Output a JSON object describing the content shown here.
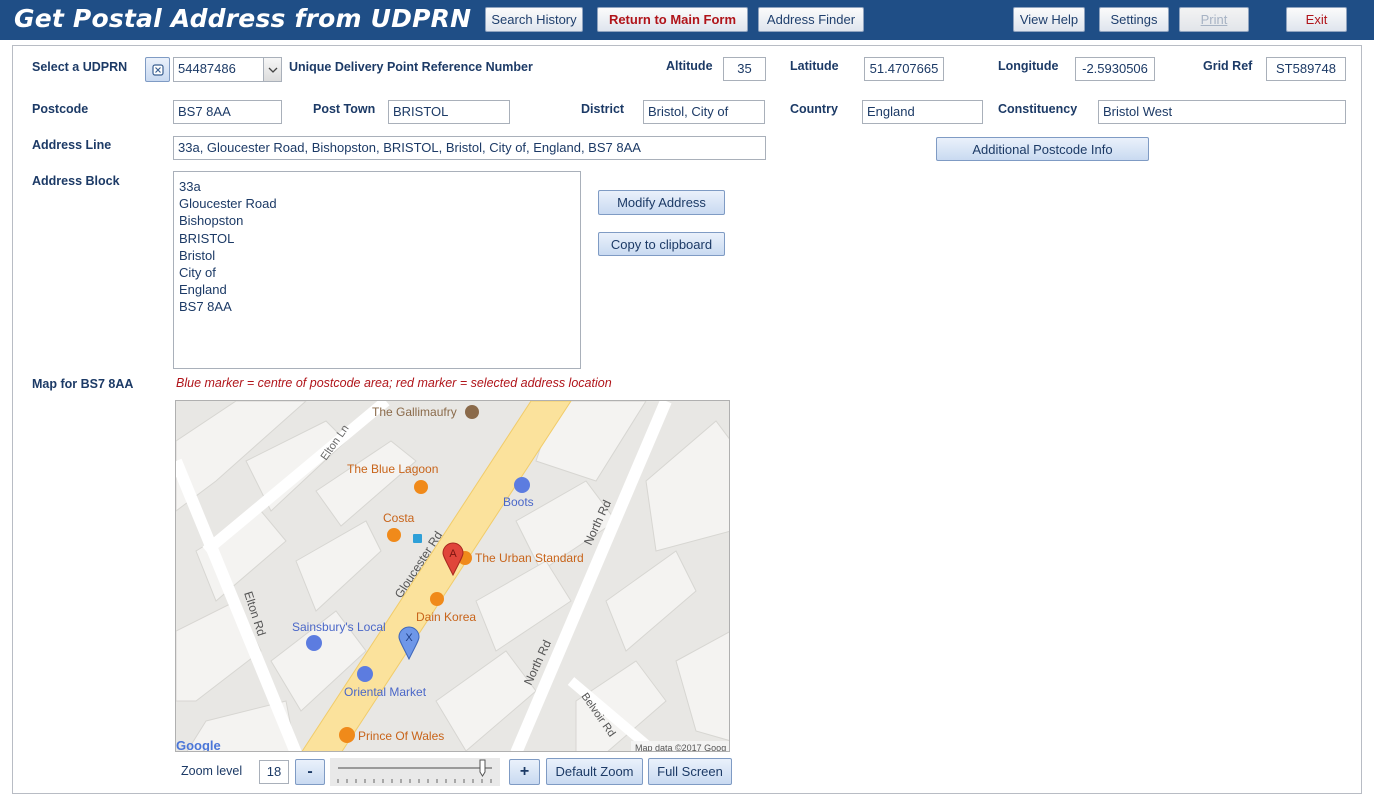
{
  "window": {
    "title": "Get Postal Address from UDPRN"
  },
  "toolbar": {
    "search_history": "Search History",
    "return_main": "Return to Main Form",
    "address_finder": "Address Finder",
    "view_help": "View Help",
    "settings": "Settings",
    "print": "Print",
    "exit": "Exit"
  },
  "fields": {
    "udprn_label": "Select a UDPRN",
    "udprn_value": "54487486",
    "udprn_desc": "Unique Delivery Point Reference Number",
    "altitude_label": "Altitude",
    "altitude_value": "35",
    "latitude_label": "Latitude",
    "latitude_value": "51.4707665",
    "longitude_label": "Longitude",
    "longitude_value": "-2.5930506",
    "gridref_label": "Grid Ref",
    "gridref_value": "ST589748",
    "postcode_label": "Postcode",
    "postcode_value": "BS7 8AA",
    "posttown_label": "Post Town",
    "posttown_value": "BRISTOL",
    "district_label": "District",
    "district_value": "Bristol, City of",
    "country_label": "Country",
    "country_value": "England",
    "constituency_label": "Constituency",
    "constituency_value": "Bristol West",
    "addressline_label": "Address Line",
    "addressline_value": "33a, Gloucester Road, Bishopston, BRISTOL, Bristol, City of, England, BS7 8AA",
    "addressblock_label": "Address Block",
    "address_block_lines": [
      "33a",
      "Gloucester Road",
      "Bishopston",
      "BRISTOL",
      "Bristol",
      "City of",
      "England",
      "BS7 8AA"
    ]
  },
  "buttons": {
    "additional_postcode": "Additional Postcode Info",
    "modify_address": "Modify Address",
    "copy_clipboard": "Copy to clipboard"
  },
  "map": {
    "label": "Map for BS7 8AA",
    "hint": "Blue marker = centre of postcode area; red marker = selected address location",
    "places": {
      "gallimaufry": "The Gallimaufry",
      "blue_lagoon": "The Blue Lagoon",
      "boots": "Boots",
      "costa": "Costa",
      "urban_standard": "The Urban Standard",
      "dain_korea": "Dain Korea",
      "sainsburys": "Sainsbury's Local",
      "oriental_market": "Oriental Market",
      "prince_of_wales": "Prince Of Wales"
    },
    "roads": {
      "elton_ln": "Elton Ln",
      "gloucester_rd": "Gloucester Rd",
      "north_rd_top": "North Rd",
      "north_rd_bottom": "North Rd",
      "elton_rd": "Elton Rd",
      "belvoir_rd": "Belvoir Rd"
    },
    "marker_red": "A",
    "marker_blue": "X",
    "google": "Google",
    "credit": "Map data ©2017 Goog"
  },
  "zoom": {
    "label": "Zoom level",
    "value": "18",
    "minus": "-",
    "plus": "+",
    "default_zoom": "Default Zoom",
    "full_screen": "Full Screen"
  },
  "colors": {
    "title_bar": "#1f4e86",
    "label_text": "#1c3a66",
    "accent_red": "#b0141a",
    "button_fill": "#c9daf1"
  }
}
